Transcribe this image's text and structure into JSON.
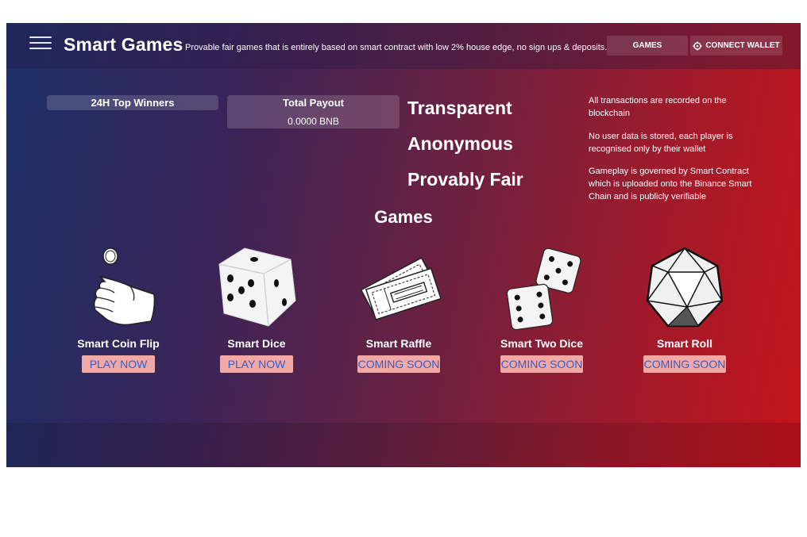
{
  "header": {
    "title": "Smart Games",
    "tagline": "Provable fair games that is entirely based on smart contract with low 2% house edge, no sign ups & deposits.",
    "games_label": "GAMES",
    "wallet_label": "CONNECT WALLET"
  },
  "stats": {
    "winners_title": "24H Top Winners",
    "payout_title": "Total Payout",
    "payout_value": "0.0000 BNB"
  },
  "features": [
    {
      "title": "Transparent",
      "desc": "All transactions are recorded on the blockchain"
    },
    {
      "title": "Anonymous",
      "desc": "No user data is stored, each player is recognised only by their wallet"
    },
    {
      "title": "Provably Fair",
      "desc": "Gameplay is governed by Smart Contract which is uploaded onto the Binance Smart Chain and is publicly verifiable"
    }
  ],
  "games_heading": "Games",
  "games": [
    {
      "name": "Smart Coin Flip",
      "action": "PLAY NOW",
      "icon": "coin-flip-icon"
    },
    {
      "name": "Smart Dice",
      "action": "PLAY NOW",
      "icon": "dice-icon"
    },
    {
      "name": "Smart Raffle",
      "action": "COMING SOON",
      "icon": "ticket-icon"
    },
    {
      "name": "Smart Two Dice",
      "action": "COMING SOON",
      "icon": "two-dice-icon"
    },
    {
      "name": "Smart Roll",
      "action": "COMING SOON",
      "icon": "d20-icon"
    }
  ],
  "colors": {
    "gradient_left": "#1b3067",
    "gradient_right": "#c4131a",
    "button_bg": "#f2a9a6",
    "button_text": "#2f5fd0"
  }
}
